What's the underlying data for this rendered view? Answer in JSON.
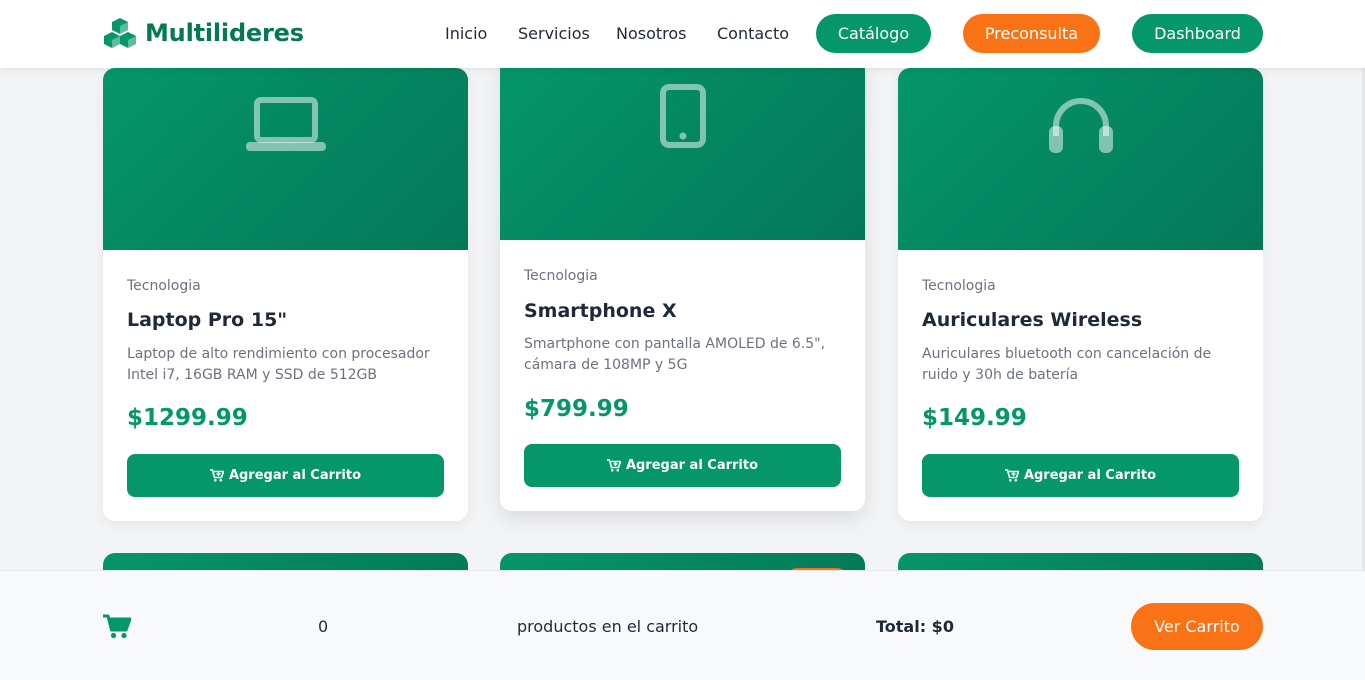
{
  "header": {
    "brand": "Multilideres",
    "nav": [
      "Inicio",
      "Servicios",
      "Nosotros",
      "Contacto"
    ],
    "buttons": {
      "catalog": "Catálogo",
      "preconsulta": "Preconsulta",
      "dashboard": "Dashboard"
    }
  },
  "products": [
    {
      "category": "Tecnologia",
      "name": "Laptop Pro 15\"",
      "description": "Laptop de alto rendimiento con procesador Intel i7, 16GB RAM y SSD de 512GB",
      "price": "$1299.99",
      "button": "Agregar al Carrito",
      "icon": "laptop-icon"
    },
    {
      "category": "Tecnologia",
      "name": "Smartphone X",
      "description": "Smartphone con pantalla AMOLED de 6.5\", cámara de 108MP y 5G",
      "price": "$799.99",
      "button": "Agregar al Carrito",
      "icon": "smartphone-icon"
    },
    {
      "category": "Tecnologia",
      "name": "Auriculares Wireless",
      "description": "Auriculares bluetooth con cancelación de ruido y 30h de batería",
      "price": "$149.99",
      "button": "Agregar al Carrito",
      "icon": "headphones-icon"
    }
  ],
  "cart": {
    "count": "0",
    "label": "productos en el carrito",
    "total": "Total: $0",
    "button": "Ver Carrito"
  },
  "colors": {
    "primary": "#059669",
    "primary_dark": "#047857",
    "accent": "#f97316"
  }
}
